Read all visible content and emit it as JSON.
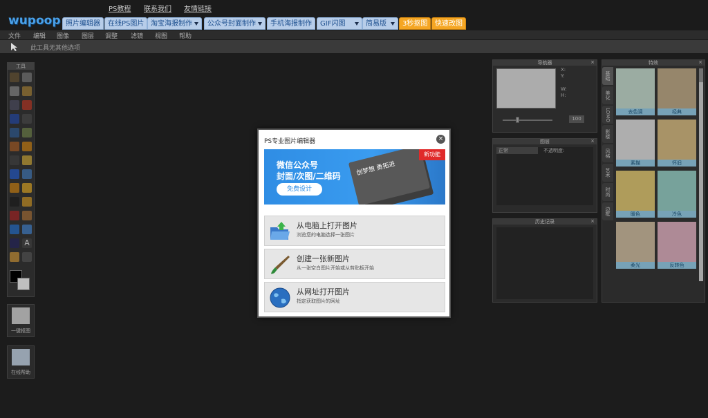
{
  "header": {
    "logo": "wupoop",
    "links": [
      "PS教程",
      "联系我们",
      "友情链接"
    ],
    "tabs": [
      {
        "label": "照片编辑器",
        "style": "blue",
        "dropdown": false
      },
      {
        "label": "在线PS图片",
        "style": "blue",
        "dropdown": false
      },
      {
        "label": "淘宝海报制作",
        "style": "blue",
        "dropdown": true
      },
      {
        "label": "公众号封面制作",
        "style": "blue",
        "dropdown": true
      },
      {
        "label": "手机海报制作",
        "style": "blue",
        "dropdown": false
      },
      {
        "label": "GIF闪图",
        "style": "blue",
        "dropdown": true
      },
      {
        "label": "简易版",
        "style": "blue",
        "dropdown": true
      },
      {
        "label": "3秒抠图",
        "style": "orange",
        "dropdown": false
      },
      {
        "label": "快速改图",
        "style": "orange",
        "dropdown": false
      }
    ]
  },
  "menu": {
    "items": [
      "文件",
      "编辑",
      "图像",
      "图层",
      "调整",
      "滤镜",
      "视图",
      "帮助"
    ]
  },
  "options_bar": {
    "text": "此工具无其他选项"
  },
  "toolbox": {
    "title": "工具"
  },
  "side_buttons": [
    {
      "label": "一键抠图"
    },
    {
      "label": "在线帮助"
    }
  ],
  "navigator": {
    "title": "导航器",
    "zoom": "100",
    "x_label": "X:",
    "y_label": "Y:",
    "w_label": "W:",
    "h_label": "H:"
  },
  "layers": {
    "title": "图层",
    "mode": "正常",
    "opacity_label": "不透明度:"
  },
  "history": {
    "title": "历史记录"
  },
  "effects": {
    "title": "特效",
    "tabs": [
      "基础",
      "美化",
      "LOMO",
      "影楼",
      "风格",
      "艺术",
      "时尚",
      "边框"
    ],
    "active_tab": 0,
    "thumbs": [
      {
        "caption": "去色调",
        "bg": "#cfe6d9"
      },
      {
        "caption": "经典",
        "bg": "#c9b38f"
      },
      {
        "caption": "素描",
        "bg": "#e9e9e9"
      },
      {
        "caption": "怀旧",
        "bg": "#e0c48a"
      },
      {
        "caption": "暖色",
        "bg": "#ead07a"
      },
      {
        "caption": "冷色",
        "bg": "#9fd9cf"
      },
      {
        "caption": "柔光",
        "bg": "#d8c6a8"
      },
      {
        "caption": "反转色",
        "bg": "#e9b8c9"
      }
    ],
    "colors": {
      "caption_bg": "#9fd8f5"
    }
  },
  "modal": {
    "title": "PS专业图片编辑器",
    "close_icon": "close-icon",
    "banner": {
      "line1": "微信公众号",
      "line2": "封面/次图/二维码",
      "button": "免费设计",
      "card_text": "创梦想 勇拓进",
      "badge": "新功能",
      "colors": {
        "bg": "#2f8de4",
        "badge": "#e02a2a"
      }
    },
    "actions": [
      {
        "title": "从电脑上打开图片",
        "desc": "浏览您的电脑选择一张图片",
        "icon": "folder-open-icon"
      },
      {
        "title": "创建一张新图片",
        "desc": "从一张空白图片开始或从剪贴板开始",
        "icon": "paintbrush-icon"
      },
      {
        "title": "从网址打开图片",
        "desc": "指定获取图片的网址",
        "icon": "globe-icon"
      }
    ]
  }
}
